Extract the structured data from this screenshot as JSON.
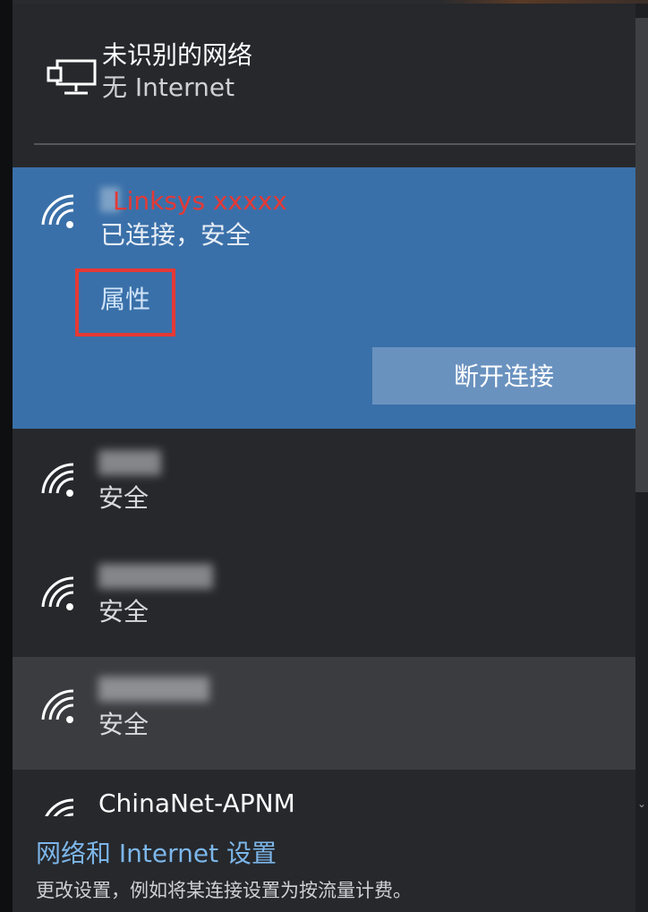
{
  "header": {
    "icon": "ethernet-icon",
    "title": "未识别的网络",
    "status": "无 Internet"
  },
  "connected": {
    "icon": "wifi-icon",
    "name": "Linksys xxxxx",
    "status": "已连接，安全",
    "properties_label": "属性",
    "disconnect_label": "断开连接",
    "accent_color": "#3a70a9",
    "highlight_color": "#e53935"
  },
  "networks": [
    {
      "icon": "wifi-icon",
      "status": "安全"
    },
    {
      "icon": "wifi-icon",
      "status": "安全"
    },
    {
      "icon": "wifi-icon",
      "status": "安全"
    },
    {
      "icon": "wifi-icon",
      "name": "ChinaNet-APNM"
    }
  ],
  "footer": {
    "settings_link": "网络和 Internet 设置",
    "description": "更改设置，例如将某连接设置为按流量计费。",
    "link_color": "#7cb6ea"
  }
}
